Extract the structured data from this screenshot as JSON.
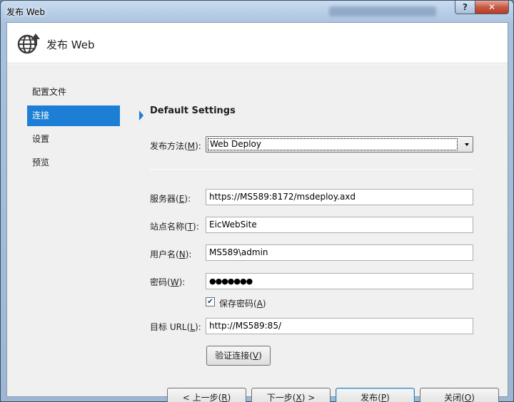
{
  "window": {
    "title": "发布 Web",
    "help_label": "?",
    "close_label": "✕"
  },
  "header": {
    "icon": "globe-publish-icon",
    "title": "发布 Web"
  },
  "nav": {
    "items": [
      {
        "label": "配置文件",
        "active": false
      },
      {
        "label": "连接",
        "active": true
      },
      {
        "label": "设置",
        "active": false
      },
      {
        "label": "预览",
        "active": false
      }
    ]
  },
  "main": {
    "section_title": "Default Settings",
    "publish_method": {
      "label": "发布方法",
      "mnemonic": "M",
      "value": "Web Deploy"
    },
    "server": {
      "label": "服务器",
      "mnemonic": "E",
      "value": "https://MS589:8172/msdeploy.axd"
    },
    "site_name": {
      "label": "站点名称",
      "mnemonic": "T",
      "value": "EicWebSite"
    },
    "user_name": {
      "label": "用户名",
      "mnemonic": "N",
      "value": "MS589\\admin"
    },
    "password": {
      "label": "密码",
      "mnemonic": "W",
      "value": "●●●●●●●"
    },
    "save_password": {
      "label": "保存密码",
      "mnemonic": "A",
      "checked": true
    },
    "target_url": {
      "label": "目标 URL",
      "mnemonic": "L",
      "value": "http://MS589:85/"
    },
    "validate_button": {
      "label": "验证连接",
      "mnemonic": "V"
    }
  },
  "footer": {
    "prev": {
      "label": "< 上一步",
      "mnemonic": "R"
    },
    "next": {
      "label": "下一步",
      "mnemonic": "X",
      "suffix": ">"
    },
    "publish": {
      "label": "发布",
      "mnemonic": "P"
    },
    "close": {
      "label": "关闭",
      "mnemonic": "O"
    }
  },
  "colors": {
    "nav_active": "#1c7ed4",
    "close_button": "#c75a45"
  }
}
